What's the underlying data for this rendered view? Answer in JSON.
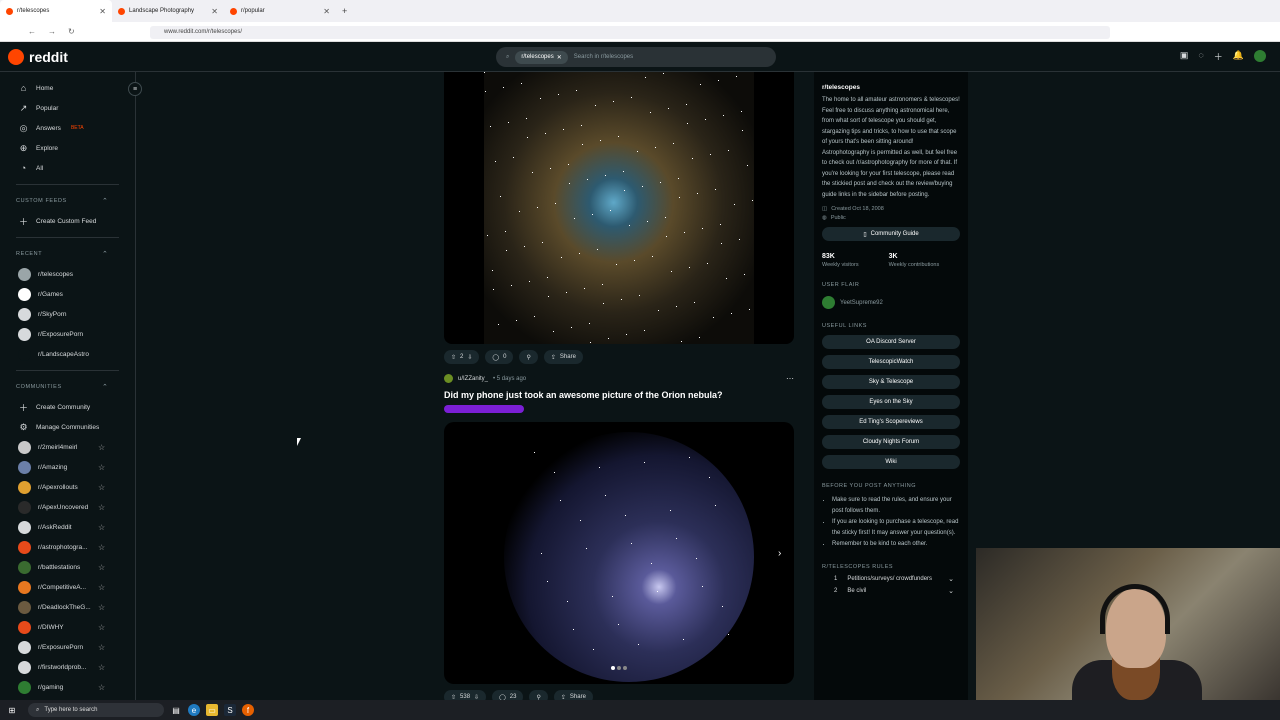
{
  "browser": {
    "tabs": [
      {
        "label": "r/telescopes"
      },
      {
        "label": "Landscape Photography"
      },
      {
        "label": "r/popular"
      }
    ],
    "url": "www.reddit.com/r/telescopes/"
  },
  "header": {
    "logo_text": "reddit",
    "search_chip": "r/telescopes",
    "search_placeholder": "Search in r/telescopes"
  },
  "sidebar": {
    "nav": [
      {
        "label": "Home",
        "icon": "home-icon"
      },
      {
        "label": "Popular",
        "icon": "popular-icon"
      },
      {
        "label": "Answers",
        "icon": "answers-icon",
        "badge": "BETA"
      },
      {
        "label": "Explore",
        "icon": "explore-icon"
      },
      {
        "label": "All",
        "icon": "all-icon"
      }
    ],
    "custom_feeds_heading": "CUSTOM FEEDS",
    "create_custom_feed": "Create Custom Feed",
    "recent_heading": "RECENT",
    "recent": [
      {
        "label": "r/telescopes",
        "color": "#9aa5a8"
      },
      {
        "label": "r/Games",
        "color": "#ffffff"
      },
      {
        "label": "r/SkyPorn",
        "color": "#d7dadc"
      },
      {
        "label": "r/ExposurePorn",
        "color": "#d7dadc"
      },
      {
        "label": "r/LandscapeAstro",
        "color": "#0b1416"
      }
    ],
    "communities_heading": "COMMUNITIES",
    "create_community": "Create Community",
    "manage_communities": "Manage Communities",
    "communities": [
      {
        "label": "r/2meirl4meirl",
        "color": "#c9c9c9"
      },
      {
        "label": "r/Amazing",
        "color": "#6b7fa8"
      },
      {
        "label": "r/Apexrollouts",
        "color": "#e0a030"
      },
      {
        "label": "r/ApexUncovered",
        "color": "#2a2a2a"
      },
      {
        "label": "r/AskReddit",
        "color": "#d7dadc"
      },
      {
        "label": "r/astrophotogra...",
        "color": "#e84a1a"
      },
      {
        "label": "r/battlestations",
        "color": "#3a6b30"
      },
      {
        "label": "r/CompetitiveA...",
        "color": "#e87820"
      },
      {
        "label": "r/DeadlockTheG...",
        "color": "#6b5a40"
      },
      {
        "label": "r/DIWHY",
        "color": "#e84a1a"
      },
      {
        "label": "r/ExposurePorn",
        "color": "#d7dadc"
      },
      {
        "label": "r/firstworldprob...",
        "color": "#d7dadc"
      },
      {
        "label": "r/gaming",
        "color": "#2e7d32"
      }
    ]
  },
  "post1": {
    "votes": "2",
    "comments": "0",
    "share": "Share"
  },
  "post2": {
    "user": "u/IZZanity_",
    "time": "• 5 days ago",
    "title": "Did my phone just took an awesome picture of the Orion nebula?",
    "votes": "538",
    "comments": "23",
    "share": "Share"
  },
  "right": {
    "title": "r/telescopes",
    "description": "The home to all amateur astronomers & telescopes! Feel free to discuss anything astronomical here, from what sort of telescope you should get, stargazing tips and tricks, to how to use that scope of yours that's been sitting around! Astrophotography is permitted as well, but feel free to check out /r/astrophotography for more of that. If you're looking for your first telescope, please read the stickied post and check out the review/buying guide links in the sidebar before posting.",
    "created": "Created Oct 18, 2008",
    "visibility": "Public",
    "community_guide": "Community Guide",
    "visitors_num": "83K",
    "visitors_label": "Weekly visitors",
    "contrib_num": "3K",
    "contrib_label": "Weekly contributions",
    "user_flair_heading": "USER FLAIR",
    "user_flair_name": "YeetSupreme92",
    "useful_links_heading": "USEFUL LINKS",
    "links": [
      "OA Discord Server",
      "TelescopicWatch",
      "Sky & Telescope",
      "Eyes on the Sky",
      "Ed Ting's Scopereviews",
      "Cloudy Nights Forum",
      "Wiki"
    ],
    "before_heading": "BEFORE YOU POST ANYTHING",
    "before_items": [
      "Make sure to read the rules, and ensure your post follows them.",
      "If you are looking to purchase a telescope, read the sticky first! It may answer your question(s).",
      "Remember to be kind to each other."
    ],
    "rules_heading": "R/TELESCOPES RULES",
    "rules": [
      {
        "num": "1",
        "label": "Petitions/surveys/ crowdfunders"
      },
      {
        "num": "2",
        "label": "Be civil"
      }
    ]
  },
  "taskbar": {
    "search_placeholder": "Type here to search"
  }
}
